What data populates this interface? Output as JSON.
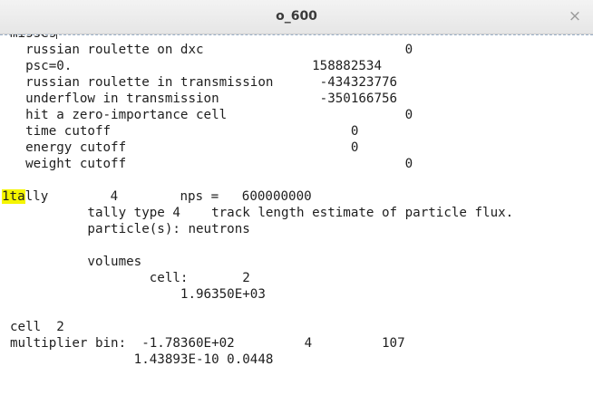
{
  "window": {
    "title": "o_600",
    "close_glyph": "×"
  },
  "editor": {
    "partial_top_line": "misses",
    "lines": [
      "  russian roulette on dxc                          0",
      "  psc=0.                               158882534",
      "  russian roulette in transmission      -434323776",
      "  underflow in transmission             -350166756",
      "  hit a zero-importance cell                       0",
      "  time cutoff                               0",
      "  energy cutoff                             0",
      "  weight cutoff                                    0",
      "",
      "tally        4        nps =   600000000",
      "          tally type 4    track length estimate of particle flux.",
      "          particle(s): neutrons",
      "",
      "          volumes",
      "                  cell:       2",
      "                      1.96350E+03",
      "",
      "cell  2",
      "multiplier bin:  -1.78360E+02         4         107",
      "                1.43893E-10 0.0448"
    ],
    "highlight": {
      "prefix": "1",
      "match": "1ta"
    },
    "highlight_color": "#f5f500"
  }
}
